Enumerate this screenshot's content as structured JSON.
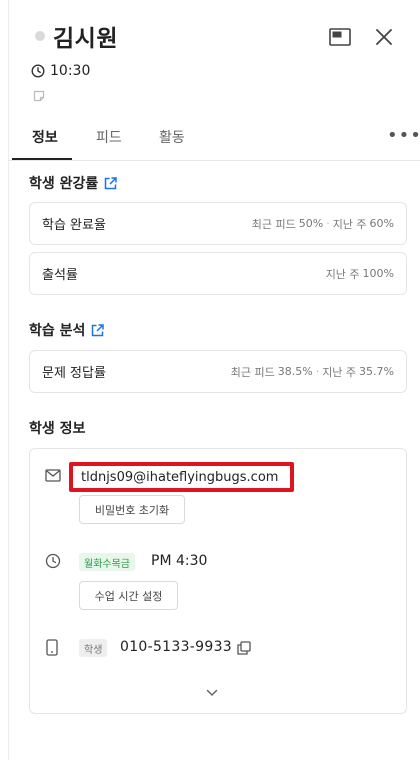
{
  "header": {
    "student_name": "김시원",
    "time": "10:30"
  },
  "tabs": [
    {
      "label": "정보"
    },
    {
      "label": "피드"
    },
    {
      "label": "활동"
    }
  ],
  "more_label": "•••",
  "completion": {
    "title": "학생 완강률",
    "metrics": [
      {
        "label": "학습 완료율",
        "recent_label": "최근 피드",
        "recent_value": "50%",
        "last_week_label": "지난 주",
        "last_week_value": "60%"
      },
      {
        "label": "출석률",
        "last_week_label": "지난 주",
        "last_week_value": "100%"
      }
    ]
  },
  "analysis": {
    "title": "학습 분석",
    "metrics": [
      {
        "label": "문제 정답률",
        "recent_label": "최근 피드",
        "recent_value": "38.5%",
        "last_week_label": "지난 주",
        "last_week_value": "35.7%"
      }
    ]
  },
  "student_info": {
    "title": "학생 정보",
    "email": "tldnjs09@ihateflyingbugs.com",
    "reset_password_label": "비밀번호 초기화",
    "class_days": "월화수목금",
    "class_time": "PM 4:30",
    "set_class_time_label": "수업 시간 설정",
    "phone_tag": "학생",
    "phone": "010-5133-9933"
  },
  "colors": {
    "link_blue": "#1a73e8",
    "highlight_red": "#e0141e",
    "tag_green": "#2c9a4a"
  }
}
